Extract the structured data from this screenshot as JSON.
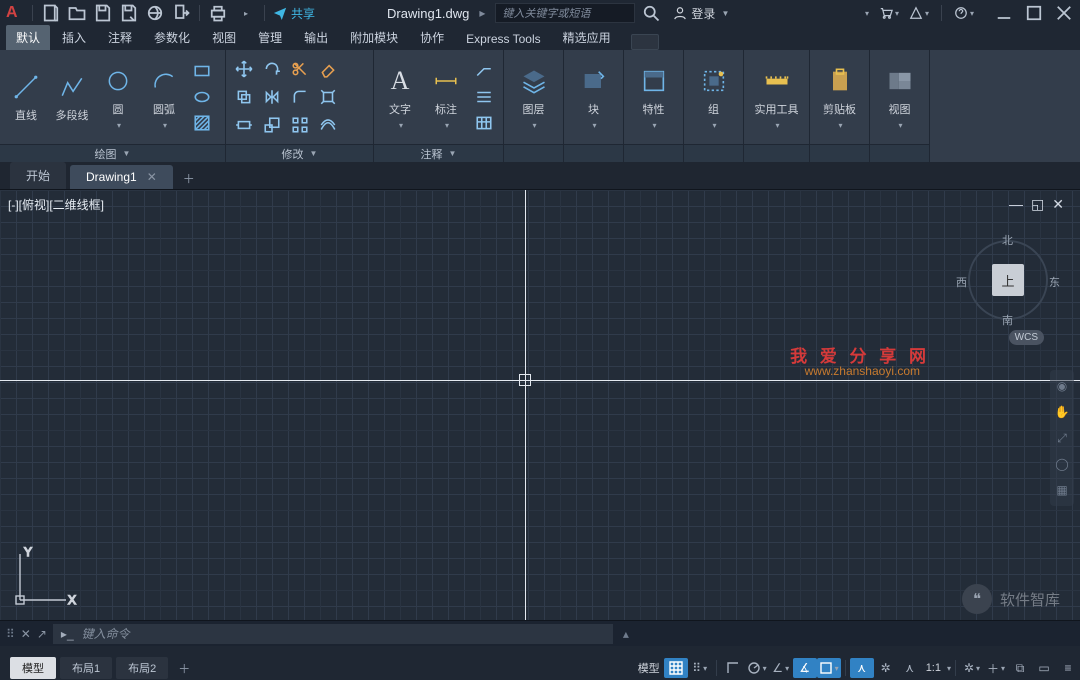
{
  "qat": {
    "share": "共享",
    "doc": "Drawing1.dwg",
    "searchPlaceholder": "键入关键字或短语",
    "login": "登录"
  },
  "ribbonTabs": [
    "默认",
    "插入",
    "注释",
    "参数化",
    "视图",
    "管理",
    "输出",
    "附加模块",
    "协作",
    "Express Tools",
    "精选应用"
  ],
  "panels": {
    "draw": {
      "title": "绘图",
      "line": "直线",
      "pline": "多段线",
      "circle": "圆",
      "arc": "圆弧"
    },
    "modify": {
      "title": "修改"
    },
    "annot": {
      "title": "注释",
      "text": "文字",
      "dim": "标注"
    },
    "layer": {
      "title": "图层"
    },
    "block": {
      "title": "块"
    },
    "prop": {
      "title": "特性"
    },
    "group": {
      "title": "组"
    },
    "util": {
      "title": "实用工具"
    },
    "clip": {
      "title": "剪贴板"
    },
    "view": {
      "title": "视图"
    }
  },
  "docTabs": {
    "start": "开始",
    "drawing": "Drawing1"
  },
  "viewport": {
    "label": "[-][俯视][二维线框]"
  },
  "navcube": {
    "top": "上",
    "n": "北",
    "s": "南",
    "e": "东",
    "w": "西",
    "wcs": "WCS"
  },
  "watermark": {
    "line1": "我 爱 分 享 网",
    "line2": "www.zhanshaoyi.com",
    "bottom": "软件智库"
  },
  "cmd": {
    "placeholder": "键入命令"
  },
  "modelTabs": {
    "model": "模型",
    "l1": "布局1",
    "l2": "布局2"
  },
  "status": {
    "model": "模型",
    "scale": "1:1"
  }
}
